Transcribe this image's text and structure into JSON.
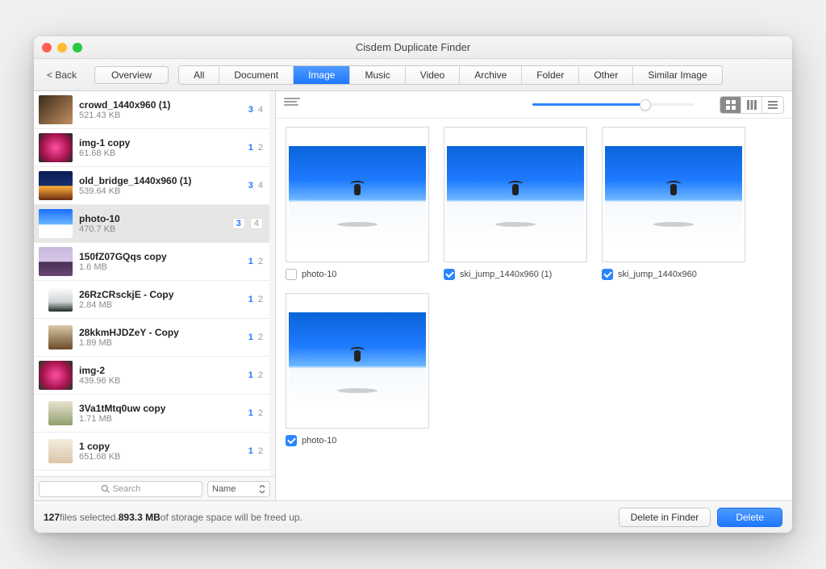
{
  "window": {
    "title": "Cisdem Duplicate Finder"
  },
  "toolbar": {
    "back": "< Back",
    "overview": "Overview",
    "tabs": [
      "All",
      "Document",
      "Image",
      "Music",
      "Video",
      "Archive",
      "Folder",
      "Other",
      "Similar Image"
    ],
    "active_tab_index": 2
  },
  "sidebar": {
    "search_placeholder": "Search",
    "sort_label": "Name",
    "items": [
      {
        "name": "crowd_1440x960 (1)",
        "size": "521.43 KB",
        "c1": "3",
        "c2": "4",
        "thumb": "th-a",
        "indent": false,
        "selected": false
      },
      {
        "name": "img-1 copy",
        "size": "61.68 KB",
        "c1": "1",
        "c2": "2",
        "thumb": "th-b",
        "indent": false,
        "selected": false
      },
      {
        "name": "old_bridge_1440x960 (1)",
        "size": "539.64 KB",
        "c1": "3",
        "c2": "4",
        "thumb": "th-c",
        "indent": false,
        "selected": false
      },
      {
        "name": "photo-10",
        "size": "470.7 KB",
        "c1": "3",
        "c2": "4",
        "thumb": "th-d",
        "indent": false,
        "selected": true
      },
      {
        "name": "150fZ07GQqs copy",
        "size": "1.6 MB",
        "c1": "1",
        "c2": "2",
        "thumb": "th-e",
        "indent": false,
        "selected": false
      },
      {
        "name": "26RzCRsckjE - Copy",
        "size": "2.84 MB",
        "c1": "1",
        "c2": "2",
        "thumb": "th-f",
        "indent": true,
        "selected": false
      },
      {
        "name": "28kkmHJDZeY - Copy",
        "size": "1.89 MB",
        "c1": "1",
        "c2": "2",
        "thumb": "th-g",
        "indent": true,
        "selected": false
      },
      {
        "name": "img-2",
        "size": "439.96 KB",
        "c1": "1",
        "c2": "2",
        "thumb": "th-h",
        "indent": false,
        "selected": false
      },
      {
        "name": "3Va1tMtq0uw copy",
        "size": "1.71 MB",
        "c1": "1",
        "c2": "2",
        "thumb": "th-i",
        "indent": true,
        "selected": false
      },
      {
        "name": "1 copy",
        "size": "651.68 KB",
        "c1": "1",
        "c2": "2",
        "thumb": "th-j",
        "indent": true,
        "selected": false
      }
    ]
  },
  "gallery": {
    "slider_percent": 70,
    "items": [
      {
        "label": "photo-10",
        "checked": false
      },
      {
        "label": "ski_jump_1440x960 (1)",
        "checked": true
      },
      {
        "label": "ski_jump_1440x960",
        "checked": true
      },
      {
        "label": "photo-10",
        "checked": true
      }
    ]
  },
  "status": {
    "count": "127",
    "mid": " files selected. ",
    "size": "893.3 MB",
    "tail": " of storage space will be freed up.",
    "delete_in_finder": "Delete in Finder",
    "delete": "Delete"
  }
}
